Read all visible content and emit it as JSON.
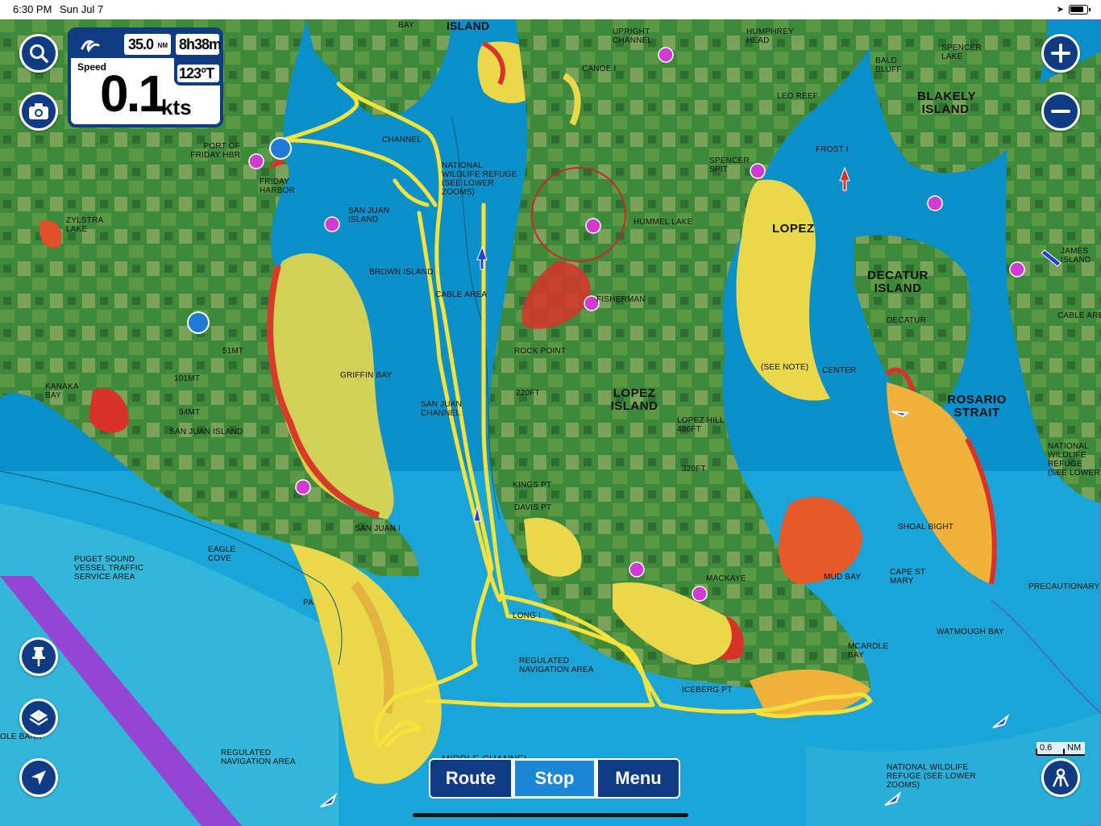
{
  "status_bar": {
    "time": "6:30 PM",
    "date": "Sun Jul 7"
  },
  "instrument": {
    "distance": "35.0",
    "distance_unit": "NM",
    "eta": "8h38m",
    "heading": "123°T",
    "speed_label": "Speed",
    "speed_value": "0.1",
    "speed_unit": "kts"
  },
  "buttons": {
    "route": "Route",
    "stop": "Stop",
    "menu": "Menu"
  },
  "scale": {
    "value": "0.6",
    "unit": "NM"
  },
  "colors": {
    "ui_navy": "#0e3b82",
    "active_blue": "#1e88d8",
    "track_yellow": "#f5e23a",
    "deep_water": "#0a8fc8",
    "land_green": "#3f8a3a",
    "traffic_lane": "#9b3fd6"
  },
  "icons": [
    "search-icon",
    "camera-icon",
    "zoom-in-icon",
    "zoom-out-icon",
    "pin-icon",
    "layers-icon",
    "locate-icon",
    "person-icon",
    "boat-logo-icon"
  ],
  "map_labels": {
    "island_top": "ISLAND",
    "bay_top": "BAY",
    "upright_channel": "UPRIGHT CHANNEL",
    "humphrey_head": "HUMPHREY HEAD",
    "spencer_lake": "SPENCER LAKE",
    "bald_bluff": "BALD BLUFF",
    "blakely_island": "BLAKELY ISLAND",
    "canoe_i": "CANOE I",
    "leo_reef": "LEO REEF",
    "frost_i": "FROST I",
    "port_of_friday_hbr": "PORT OF FRIDAY HBR",
    "friday_harbor": "FRIDAY HARBOR",
    "channel": "CHANNEL",
    "national_wildlife_refuge": "NATIONAL WILDLIFE REFUGE (SEE LOWER ZOOMS)",
    "spencer_spit": "SPENCER SPIT",
    "lopez": "LOPEZ",
    "zylstra_lake": "ZYLSTRA LAKE",
    "san_juan_island_small": "SAN JUAN ISLAND",
    "hummel_lake": "HUMMEL LAKE",
    "decatur_island": "DECATUR ISLAND",
    "james_island": "JAMES ISLAND",
    "brown_island": "BROWN ISLAND",
    "cable_area": "CABLE AREA",
    "fisherman": "FISHERMAN",
    "decatur": "DECATUR",
    "cable_area_right": "CABLE AREA",
    "rock_point": "ROCK POINT",
    "51mt": "51MT",
    "griffin_bay": "GRIFFIN BAY",
    "see_note": "(SEE NOTE)",
    "center": "CENTER",
    "220ft": "220FT",
    "lopez_island": "LOPEZ ISLAND",
    "rosario_strait": "ROSARIO STRAIT",
    "kanaka_bay": "KANAKA BAY",
    "101mt": "101MT",
    "san_juan_channel": "SAN JUAN CHANNEL",
    "lopez_hill": "LOPEZ HILL 486FT",
    "94mt": "94MT",
    "san_juan_island": "SAN JUAN ISLAND",
    "320ft": "320FT",
    "national_right": "NATIONAL WILDLIFE REFUGE (SEE LOWER",
    "kings_pt": "KINGS PT",
    "davis_pt": "DAVIS PT",
    "shoal_bight": "SHOAL BIGHT",
    "san_juan_i": "SAN JUAN I",
    "puget_sound": "PUGET SOUND VESSEL TRAFFIC SERVICE AREA",
    "eagle_cove": "EAGLE COVE",
    "mackaye": "MACKAYE",
    "mud_bay": "MUD BAY",
    "cape_st_mary": "CAPE ST MARY",
    "precautionary": "PRECAUTIONARY",
    "pa": "PA",
    "long_i": "LONG I",
    "watmough_bay": "WATMOUGH BAY",
    "mcardle_bay": "MCARDLE BAY",
    "regulated_nav": "REGULATED NAVIGATION AREA",
    "iceberg_pt": "ICEBERG PT",
    "middle_channel": "MIDDLE CHANNEL",
    "regulated_nav_left": "REGULATED NAVIGATION AREA",
    "national_bottom": "NATIONAL WILDLIFE REFUGE (SEE LOWER ZOOMS)",
    "ole_bank": "OLE BANK"
  }
}
